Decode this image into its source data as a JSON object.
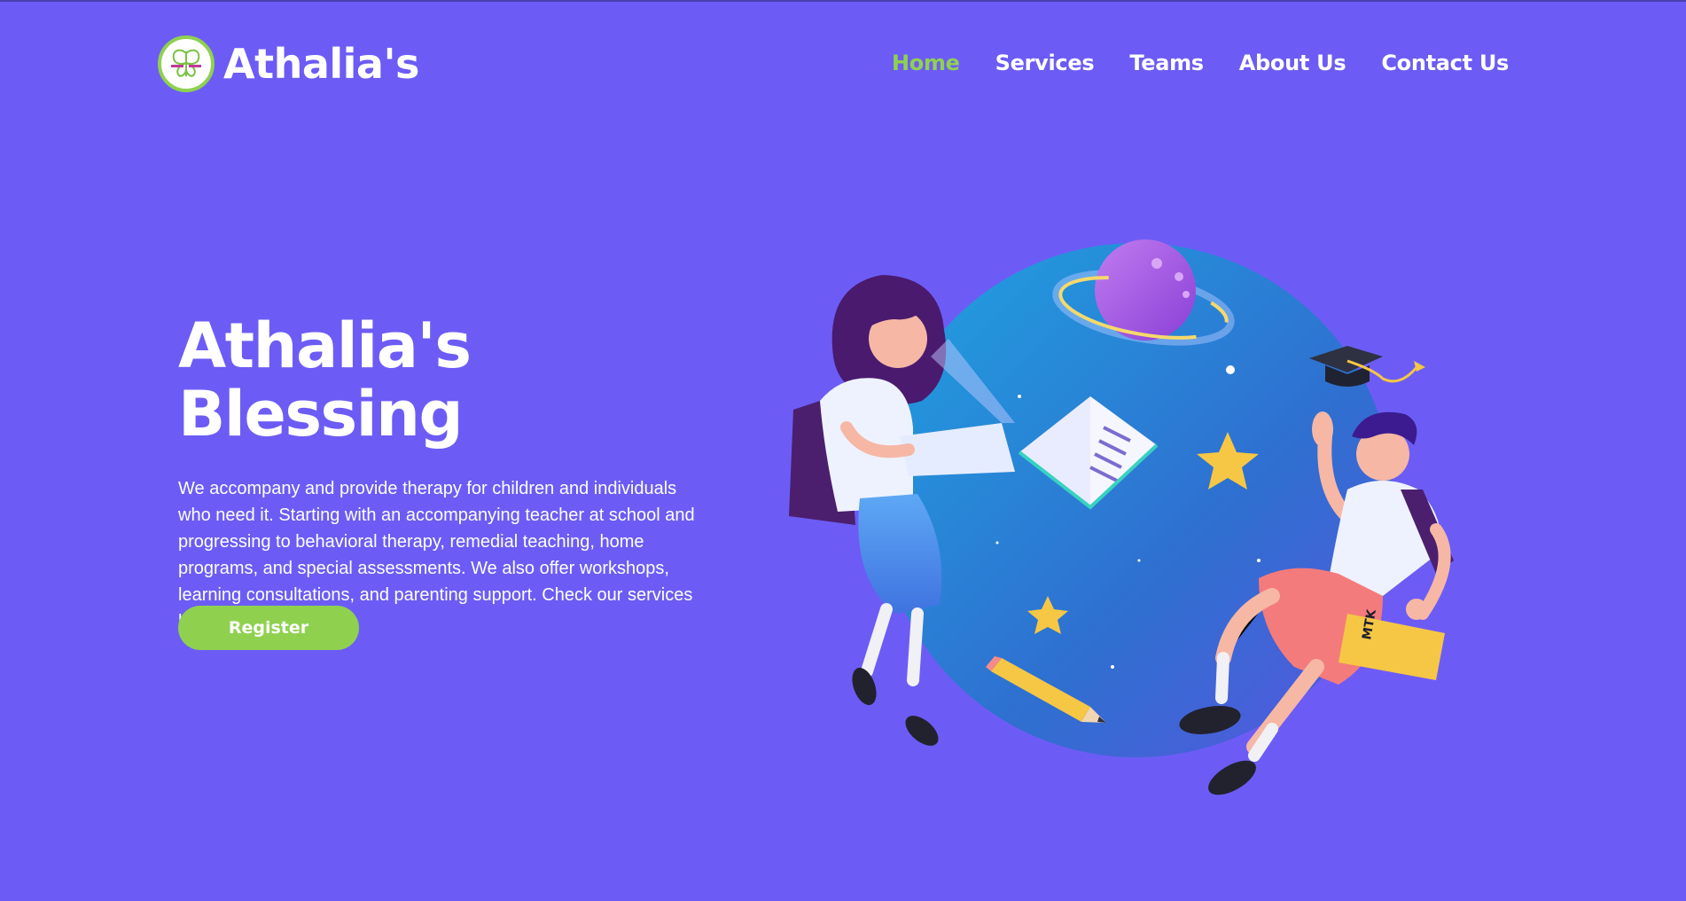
{
  "header": {
    "brand": "Athalia's",
    "logo_icon": "butterfly-logo-icon",
    "nav": [
      {
        "label": "Home",
        "active": true
      },
      {
        "label": "Services",
        "active": false
      },
      {
        "label": "Teams",
        "active": false
      },
      {
        "label": "About Us",
        "active": false
      },
      {
        "label": "Contact Us",
        "active": false
      }
    ]
  },
  "hero": {
    "title": "Athalia's Blessing",
    "description": "We accompany and provide therapy for children and individuals who need it. Starting with an accompanying teacher at school and progressing to behavioral therapy, remedial teaching, home programs, and special assessments. We also offer workshops, learning consultations, and parenting support. Check our services here!",
    "button_label": "Register"
  },
  "illustration": {
    "book_label": "MTK",
    "icons": [
      "planet-icon",
      "graduation-cap-icon",
      "book-icon",
      "star-icon",
      "pencil-icon",
      "laptop-icon"
    ]
  },
  "colors": {
    "background": "#6C5CF5",
    "accent": "#8fd14f",
    "text": "#ffffff"
  }
}
